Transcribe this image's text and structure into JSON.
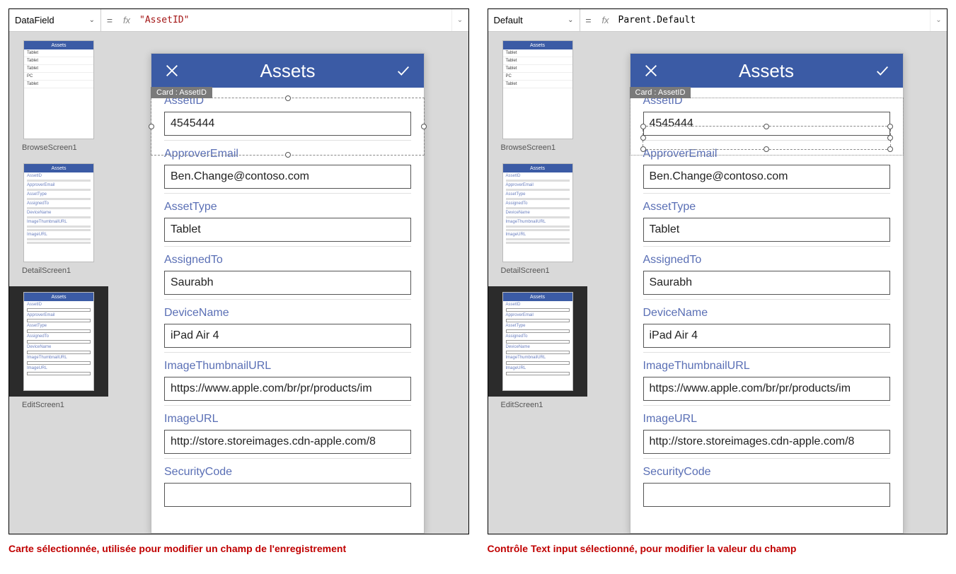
{
  "left": {
    "propDropdown": "DataField",
    "formula": "\"AssetID\"",
    "formula_is_string": true,
    "thumb_labels": [
      "BrowseScreen1",
      "DetailScreen1",
      "EditScreen1"
    ],
    "card_tag": "Card : AssetID",
    "phone_title": "Assets",
    "fields": [
      {
        "label": "AssetID",
        "value": "4545444"
      },
      {
        "label": "ApproverEmail",
        "value": "Ben.Change@contoso.com"
      },
      {
        "label": "AssetType",
        "value": "Tablet"
      },
      {
        "label": "AssignedTo",
        "value": "Saurabh"
      },
      {
        "label": "DeviceName",
        "value": "iPad Air 4"
      },
      {
        "label": "ImageThumbnailURL",
        "value": "https://www.apple.com/br/pr/products/im"
      },
      {
        "label": "ImageURL",
        "value": "http://store.storeimages.cdn-apple.com/8"
      },
      {
        "label": "SecurityCode",
        "value": ""
      }
    ],
    "thumb_head": "Assets",
    "thumb_row1": "Tablet",
    "thumb_row2": "Tablet",
    "thumb_row3": "PC",
    "thumb_row4": "Tablet",
    "caption": "Carte sélectionnée, utilisée pour modifier un champ de l'enregistrement"
  },
  "right": {
    "propDropdown": "Default",
    "formula": "Parent.Default",
    "formula_is_string": false,
    "thumb_labels": [
      "BrowseScreen1",
      "DetailScreen1",
      "EditScreen1"
    ],
    "card_tag": "Card : AssetID",
    "phone_title": "Assets",
    "fields": [
      {
        "label": "AssetID",
        "value": "4545444"
      },
      {
        "label": "ApproverEmail",
        "value": "Ben.Change@contoso.com"
      },
      {
        "label": "AssetType",
        "value": "Tablet"
      },
      {
        "label": "AssignedTo",
        "value": "Saurabh"
      },
      {
        "label": "DeviceName",
        "value": "iPad Air 4"
      },
      {
        "label": "ImageThumbnailURL",
        "value": "https://www.apple.com/br/pr/products/im"
      },
      {
        "label": "ImageURL",
        "value": "http://store.storeimages.cdn-apple.com/8"
      },
      {
        "label": "SecurityCode",
        "value": ""
      }
    ],
    "thumb_head": "Assets",
    "thumb_row1": "Tablet",
    "thumb_row2": "Tablet",
    "thumb_row3": "PC",
    "thumb_row4": "Tablet",
    "caption": "Contrôle Text input sélectionné, pour modifier la valeur du champ"
  }
}
